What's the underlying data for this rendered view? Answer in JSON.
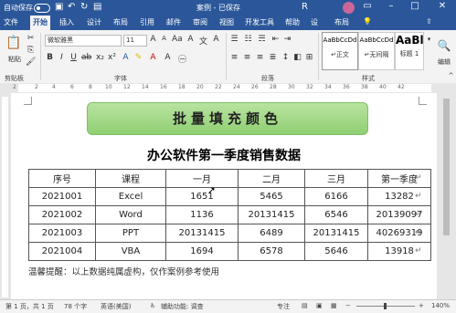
{
  "titlebar": {
    "autosave": "自动保存",
    "doc_title": "案例 - 已保存",
    "user_initial": "R"
  },
  "tabs": [
    "文件",
    "开始",
    "插入",
    "设计",
    "布局",
    "引用",
    "邮件",
    "审阅",
    "视图",
    "开发工具",
    "帮助",
    "设",
    "布局"
  ],
  "search_icon": "lightbulb-icon",
  "ribbon": {
    "paste_label": "粘贴",
    "clipboard_group": "剪贴板",
    "font_name": "微软雅黑",
    "font_size": "11",
    "font_group": "字体",
    "paragraph_group": "段落",
    "styles": [
      {
        "preview": "AaBbCcDd",
        "name": "↵正文"
      },
      {
        "preview": "AaBbCcDd",
        "name": "↵无间隔"
      },
      {
        "preview": "AaBl",
        "name": "标题 1"
      }
    ],
    "styles_group": "样式",
    "edit_label": "编辑"
  },
  "ruler_numbers": [
    "2",
    "2",
    "4",
    "6",
    "8",
    "10",
    "12",
    "14",
    "16",
    "18",
    "20",
    "22",
    "24",
    "26",
    "28",
    "30",
    "32",
    "34",
    "36",
    "38",
    "40",
    "42"
  ],
  "document": {
    "banner": "批量填充颜色",
    "title": "办公软件第一季度销售数据",
    "table": {
      "headers": [
        "序号",
        "课程",
        "一月",
        "二月",
        "三月",
        "第一季度"
      ],
      "rows": [
        [
          "2021001",
          "Excel",
          "1651",
          "5465",
          "6166",
          "13282"
        ],
        [
          "2021002",
          "Word",
          "1136",
          "20131415",
          "6546",
          "20139097"
        ],
        [
          "2021003",
          "PPT",
          "20131415",
          "6489",
          "20131415",
          "40269319"
        ],
        [
          "2021004",
          "VBA",
          "1694",
          "6578",
          "5646",
          "13918"
        ]
      ]
    },
    "note": "温馨提醒：以上数据纯属虚构，仅作案例参考使用"
  },
  "statusbar": {
    "page": "第 1 页，共 1 页",
    "words": "78 个字",
    "language": "英语(美国)",
    "accessibility": "辅助功能: 调查",
    "focus": "专注",
    "zoom": "140%"
  }
}
